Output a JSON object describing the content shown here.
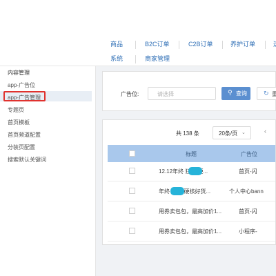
{
  "topnav": {
    "row1": [
      "商品",
      "B2C订单",
      "C2B订单",
      "养护订单",
      "这"
    ],
    "row2": [
      "系统",
      "商家管理"
    ]
  },
  "sidebar": {
    "section_title": "内容管理",
    "items": [
      {
        "label": "app-广告位"
      },
      {
        "label": "app-广告管理"
      },
      {
        "label": "专题页"
      },
      {
        "label": "首页模板"
      },
      {
        "label": "首页频道配置"
      },
      {
        "label": "分装页配置"
      },
      {
        "label": "搜索默认关键词"
      }
    ],
    "highlight_color": "#e0322e"
  },
  "filter": {
    "label": "广告位:",
    "select_placeholder": "请选择",
    "query_label": "查询",
    "reset_label": "重"
  },
  "table": {
    "total": "共 138 条",
    "page_size": "20条/页",
    "headers": [
      "标题",
      "广告位"
    ],
    "rows": [
      {
        "title": "12.12年终      狂欢 硬...",
        "position": "首页-闪"
      },
      {
        "title": "年终      狂欢 硬核好货...",
        "position": "个人中心bann"
      },
      {
        "title": "用券卖包包，最高加价1...",
        "position": "首页-闪"
      },
      {
        "title": "用券卖包包，最高加价1...",
        "position": "小程序-"
      }
    ]
  },
  "colors": {
    "nav_text": "#2f6fb6",
    "primary": "#5b8fd0",
    "table_header": "#a9c8ec",
    "redaction": "#26b3d9"
  }
}
